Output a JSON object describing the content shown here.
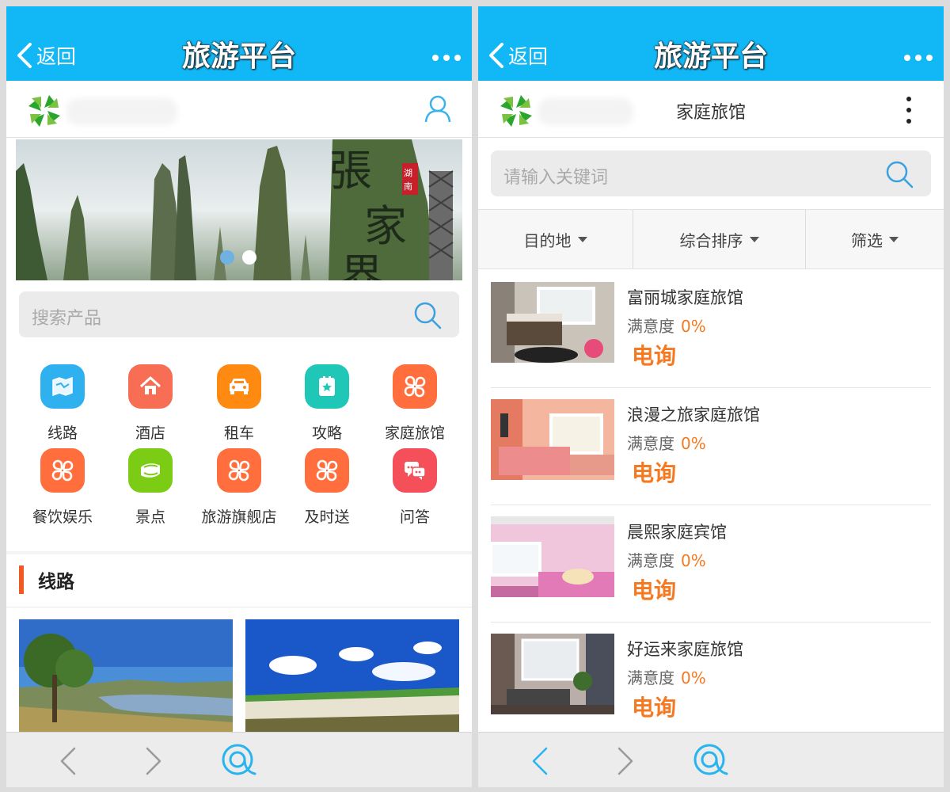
{
  "left": {
    "titlebar": {
      "back_label": "返回",
      "title": "旅游平台"
    },
    "banner": {
      "calligraphy": [
        "張",
        "家",
        "界"
      ],
      "seal": "湖南",
      "active_dot": 1,
      "dot_count": 2
    },
    "search": {
      "placeholder": "搜索产品"
    },
    "grid": [
      {
        "label": "线路",
        "icon": "map-icon",
        "color": "#2fb1f0"
      },
      {
        "label": "酒店",
        "icon": "home-icon",
        "color": "#f76e55"
      },
      {
        "label": "租车",
        "icon": "car-icon",
        "color": "#ff8a12"
      },
      {
        "label": "攻略",
        "icon": "guide-icon",
        "color": "#1fc7b6"
      },
      {
        "label": "家庭旅馆",
        "icon": "clover-icon",
        "color": "#ff6e3c"
      },
      {
        "label": "餐饮娱乐",
        "icon": "clover-icon",
        "color": "#ff6e3c"
      },
      {
        "label": "景点",
        "icon": "ticket-icon",
        "color": "#7ccc16"
      },
      {
        "label": "旅游旗舰店",
        "icon": "clover-icon",
        "color": "#ff6e3c"
      },
      {
        "label": "及时送",
        "icon": "clover-icon",
        "color": "#ff6e3c"
      },
      {
        "label": "问答",
        "icon": "chat-icon",
        "color": "#f5505a"
      }
    ],
    "section": {
      "title": "线路"
    }
  },
  "right": {
    "titlebar": {
      "back_label": "返回",
      "title": "旅游平台"
    },
    "header": {
      "title": "家庭旅馆"
    },
    "search": {
      "placeholder": "请输入关键词"
    },
    "filters": [
      "目的地",
      "综合排序",
      "筛选"
    ],
    "listings": [
      {
        "name": "富丽城家庭旅馆",
        "satisfaction_label": "满意度",
        "satisfaction": "0%",
        "price": "电询"
      },
      {
        "name": "浪漫之旅家庭旅馆",
        "satisfaction_label": "满意度",
        "satisfaction": "0%",
        "price": "电询"
      },
      {
        "name": "晨熙家庭宾馆",
        "satisfaction_label": "满意度",
        "satisfaction": "0%",
        "price": "电询"
      },
      {
        "name": "好运来家庭旅馆",
        "satisfaction_label": "满意度",
        "satisfaction": "0%",
        "price": "电询"
      }
    ]
  },
  "colors": {
    "titlebar": "#12b7f5",
    "accent": "#f47920",
    "section_bar": "#f05a24",
    "nav_icon": "#28b4ef",
    "nav_disabled": "#9a9a9a"
  }
}
